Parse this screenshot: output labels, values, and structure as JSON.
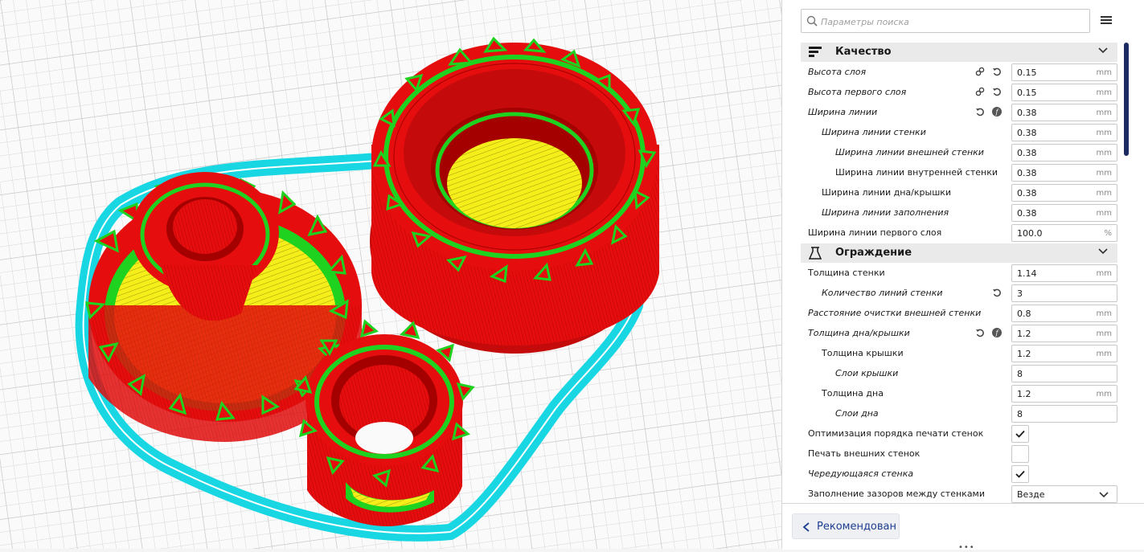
{
  "search": {
    "placeholder": "Параметры поиска"
  },
  "icons": {
    "search": "search-icon",
    "menu": "hamburger-menu-icon",
    "link": "link-icon",
    "reset": "reset-icon",
    "function": "function-icon",
    "chevron": "chevron-down-icon",
    "back": "chevron-left-icon"
  },
  "colors": {
    "accent": "#1d3d8f",
    "scrollbar": "#1c2c60",
    "model_red": "#e50d0d",
    "model_green": "#1fd21f",
    "model_yellow": "#f5ee1a",
    "skirt_cyan": "#18d7e3"
  },
  "categories": {
    "quality": "Качество",
    "shell": "Ограждение"
  },
  "quality": {
    "layer_height": {
      "label": "Высота слоя",
      "value": "0.15",
      "unit": "mm"
    },
    "initial_layer_height": {
      "label": "Высота первого слоя",
      "value": "0.15",
      "unit": "mm"
    },
    "line_width": {
      "label": "Ширина линии",
      "value": "0.38",
      "unit": "mm"
    },
    "wall_line_width": {
      "label": "Ширина линии стенки",
      "value": "0.38",
      "unit": "mm"
    },
    "outer_wall_line_width": {
      "label": "Ширина линии внешней стенки",
      "value": "0.38",
      "unit": "mm"
    },
    "inner_wall_line_width": {
      "label": "Ширина линии внутренней стенки",
      "value": "0.38",
      "unit": "mm"
    },
    "top_bottom_line_width": {
      "label": "Ширина линии дна/крышки",
      "value": "0.38",
      "unit": "mm"
    },
    "infill_line_width": {
      "label": "Ширина линии заполнения",
      "value": "0.38",
      "unit": "mm"
    },
    "initial_layer_line_width": {
      "label": "Ширина линии первого слоя",
      "value": "100.0",
      "unit": "%"
    }
  },
  "shell": {
    "wall_thickness": {
      "label": "Толщина стенки",
      "value": "1.14",
      "unit": "mm"
    },
    "wall_line_count": {
      "label": "Количество линий стенки",
      "value": "3"
    },
    "outer_wall_wipe": {
      "label": "Расстояние очистки внешней стенки",
      "value": "0.8",
      "unit": "mm"
    },
    "top_bottom_thickness": {
      "label": "Толщина дна/крышки",
      "value": "1.2",
      "unit": "mm"
    },
    "top_thickness": {
      "label": "Толщина крышки",
      "value": "1.2",
      "unit": "mm"
    },
    "top_layers": {
      "label": "Слои крышки",
      "value": "8"
    },
    "bottom_thickness": {
      "label": "Толщина дна",
      "value": "1.2",
      "unit": "mm"
    },
    "bottom_layers": {
      "label": "Слои дна",
      "value": "8"
    },
    "optimize_wall_order": {
      "label": "Оптимизация порядка печати стенок",
      "checked": true
    },
    "outer_before_inner": {
      "label": "Печать внешних стенок",
      "checked": false
    },
    "alternate_extra_wall": {
      "label": "Чередующаяся стенка",
      "checked": true
    },
    "fill_gaps": {
      "label": "Заполнение зазоров между стенками",
      "value": "Везде"
    }
  },
  "footer": {
    "recommended_label": "Рекомендован",
    "dots": "•••"
  }
}
